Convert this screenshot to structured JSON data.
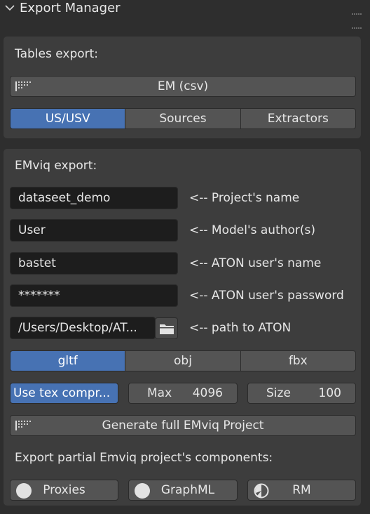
{
  "header": {
    "title": "Export Manager",
    "collapse_icon": "chevron-down-icon",
    "grip_icon": "drag-grip-icon"
  },
  "tables_export": {
    "label": "Tables export:",
    "em_csv_button": "EM (csv)",
    "tabs": [
      {
        "label": "US/USV",
        "active": true
      },
      {
        "label": "Sources",
        "active": false
      },
      {
        "label": "Extractors",
        "active": false
      }
    ]
  },
  "emviq_export": {
    "label": "EMviq export:",
    "fields": [
      {
        "value": "dataseet_demo",
        "hint": "<-- Project's name"
      },
      {
        "value": "User",
        "hint": "<-- Model's author(s)"
      },
      {
        "value": "bastet",
        "hint": "<-- ATON user's name"
      },
      {
        "value": "*******",
        "hint": "<-- ATON user's password"
      },
      {
        "value": "/Users/Desktop/AT...",
        "hint": "<-- path to ATON"
      }
    ],
    "format_tabs": [
      {
        "label": "gltf",
        "active": true
      },
      {
        "label": "obj",
        "active": false
      },
      {
        "label": "fbx",
        "active": false
      }
    ],
    "tex_compress_button": "Use tex compr...",
    "max": {
      "label": "Max",
      "value": "4096"
    },
    "size": {
      "label": "Size",
      "value": "100"
    },
    "generate_button": "Generate full EMviq Project",
    "partial_label": "Export partial Emviq project's components:",
    "partial_buttons": [
      {
        "label": "Proxies",
        "icon": "circle-icon"
      },
      {
        "label": "GraphML",
        "icon": "circle-icon"
      },
      {
        "label": "RM",
        "icon": "rm-icon"
      }
    ]
  },
  "colors": {
    "accent": "#4772b3",
    "panel": "#3d3d3d",
    "button": "#545454",
    "field": "#1d1d1d"
  }
}
